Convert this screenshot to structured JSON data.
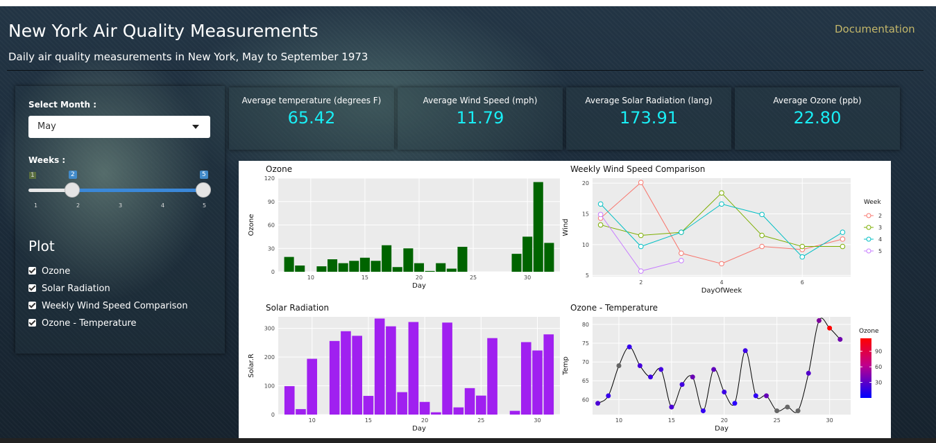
{
  "header": {
    "title": "New York Air Quality Measurements",
    "subtitle": "Daily air quality measurements in New York, May to September 1973",
    "doc_link": "Documentation"
  },
  "sidebar": {
    "month_label": "Select Month :",
    "month_value": "May",
    "weeks_label": "Weeks :",
    "weeks_min": "1",
    "weeks_max_label": "5",
    "weeks_range_lo": 2,
    "weeks_range_hi": 5,
    "weeks_ticks": [
      "1",
      "2",
      "3",
      "4",
      "5"
    ],
    "plot_heading": "Plot",
    "plot_options": [
      {
        "label": "Ozone",
        "checked": true
      },
      {
        "label": "Solar Radiation",
        "checked": true
      },
      {
        "label": "Weekly Wind Speed Comparison",
        "checked": true
      },
      {
        "label": "Ozone - Temperature",
        "checked": true
      }
    ]
  },
  "kpis": [
    {
      "label": "Average temperature (degrees F)",
      "value": "65.42"
    },
    {
      "label": "Average Wind Speed (mph)",
      "value": "11.79"
    },
    {
      "label": "Average Solar Radiation (lang)",
      "value": "173.91"
    },
    {
      "label": "Average Ozone (ppb)",
      "value": "22.80"
    }
  ],
  "colors": {
    "kpi_value": "#19eef5",
    "ozone_bar": "#006400",
    "solar_bar": "#a020f0",
    "doc_link": "#c4b76a"
  },
  "chart_data": [
    {
      "type": "bar",
      "title": "Ozone",
      "xlabel": "Day",
      "ylabel": "Ozone",
      "x": [
        8,
        9,
        11,
        12,
        13,
        14,
        15,
        16,
        17,
        18,
        19,
        20,
        21,
        22,
        23,
        24,
        29,
        30,
        31,
        32
      ],
      "values": [
        19,
        8,
        7,
        16,
        11,
        14,
        18,
        14,
        34,
        6,
        30,
        11,
        1,
        11,
        4,
        32,
        23,
        45,
        115,
        37
      ],
      "xticks": [
        10,
        15,
        20,
        25,
        30
      ],
      "yticks": [
        0,
        30,
        60,
        90,
        120
      ],
      "xlim": [
        7,
        33
      ],
      "ylim": [
        0,
        120
      ]
    },
    {
      "type": "line",
      "title": "Weekly Wind Speed Comparison",
      "xlabel": "DayOfWeek",
      "ylabel": "Wind",
      "legend_title": "Week",
      "legend_position": "right",
      "xticks": [
        2,
        4,
        6
      ],
      "yticks": [
        5,
        10,
        15,
        20
      ],
      "xlim": [
        0.8,
        7.2
      ],
      "ylim": [
        4.8,
        20.8
      ],
      "series": [
        {
          "name": "2",
          "color": "#f8766d",
          "x": [
            1,
            2,
            3,
            4,
            5,
            6,
            7
          ],
          "values": [
            14.3,
            20.1,
            8.6,
            6.9,
            9.7,
            9.2,
            10.9
          ]
        },
        {
          "name": "3",
          "color": "#7cae00",
          "x": [
            1,
            2,
            3,
            4,
            5,
            6,
            7
          ],
          "values": [
            13.2,
            11.5,
            12.0,
            18.4,
            11.5,
            9.7,
            9.7
          ]
        },
        {
          "name": "4",
          "color": "#00bfc4",
          "x": [
            1,
            2,
            3,
            4,
            5,
            6,
            7
          ],
          "values": [
            16.6,
            9.7,
            12.0,
            16.6,
            14.9,
            8.0,
            12.0
          ]
        },
        {
          "name": "5",
          "color": "#c77cff",
          "x": [
            1,
            2,
            3
          ],
          "values": [
            14.9,
            5.7,
            7.4
          ]
        }
      ]
    },
    {
      "type": "bar",
      "title": "Solar Radiation",
      "xlabel": "Day",
      "ylabel": "Solar.R",
      "x": [
        8,
        9,
        10,
        12,
        13,
        14,
        15,
        16,
        17,
        18,
        19,
        20,
        21,
        22,
        23,
        24,
        25,
        26,
        28,
        29,
        30,
        31
      ],
      "values": [
        99,
        19,
        194,
        256,
        290,
        274,
        65,
        334,
        307,
        78,
        322,
        44,
        8,
        320,
        25,
        92,
        66,
        266,
        13,
        252,
        223,
        279
      ],
      "xticks": [
        10,
        15,
        20,
        25,
        30
      ],
      "yticks": [
        0,
        100,
        200,
        300
      ],
      "xlim": [
        7,
        32
      ],
      "ylim": [
        0,
        340
      ]
    },
    {
      "type": "scatter",
      "title": "Ozone - Temperature",
      "xlabel": "Day",
      "ylabel": "Temp",
      "legend_title": "Ozone",
      "legend_position": "right",
      "legend_ticks": [
        30,
        60,
        90
      ],
      "xticks": [
        10,
        15,
        20,
        25,
        30
      ],
      "yticks": [
        60,
        65,
        70,
        75,
        80
      ],
      "xlim": [
        7.5,
        32
      ],
      "ylim": [
        56,
        82
      ],
      "x": [
        8,
        9,
        10,
        11,
        12,
        13,
        14,
        15,
        16,
        17,
        18,
        19,
        20,
        21,
        22,
        23,
        24,
        25,
        26,
        27,
        28,
        29,
        30,
        31
      ],
      "values": [
        59,
        61,
        69,
        74,
        69,
        66,
        68,
        58,
        64,
        66,
        57,
        68,
        62,
        59,
        73,
        61,
        61,
        57,
        58,
        57,
        67,
        81,
        79,
        76
      ],
      "ozone": [
        19,
        8,
        null,
        7,
        16,
        11,
        14,
        18,
        14,
        34,
        6,
        30,
        11,
        1,
        11,
        4,
        32,
        null,
        null,
        null,
        23,
        45,
        115,
        37
      ]
    }
  ]
}
